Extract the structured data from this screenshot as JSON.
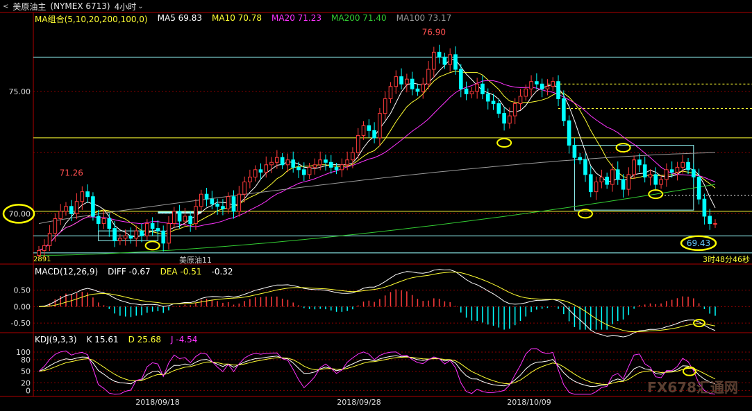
{
  "header": {
    "symbol": "美原油主",
    "code": "(NYMEX 6713)",
    "timeframe": "4小时",
    "timeframe_icon": "chevron-down-icon",
    "prev_icon": "chevron-left-icon"
  },
  "ma_legend": {
    "group": "MA组合(5,10,20,200,100,0)",
    "items": [
      {
        "label": "MA5 69.83",
        "color": "#ffffff"
      },
      {
        "label": "MA10 70.78",
        "color": "#ffff33"
      },
      {
        "label": "MA20 71.23",
        "color": "#ff33ff"
      },
      {
        "label": "MA200 71.40",
        "color": "#33cc33"
      },
      {
        "label": "MA100 73.17",
        "color": "#9a9a9a"
      }
    ]
  },
  "price_panel": {
    "y_ticks": [
      "75.00",
      "70.00"
    ],
    "high_label": "76.90",
    "left_high_label": "71.26",
    "low_label": "69.43",
    "left_tag": "2891",
    "contract_label": "美原油11",
    "countdown": "3时48分46秒"
  },
  "macd_legend": {
    "title": "MACD(12,26,9)",
    "diff": "DIFF -0.67",
    "dea": "DEA -0.51",
    "macd": "-0.32"
  },
  "kdj_legend": {
    "title": "KDJ(9,3,3)",
    "k": "K 15.61",
    "d": "D 25.68",
    "j": "J -4.54"
  },
  "dates": [
    "2018/09/18",
    "2018/09/28",
    "2018/10/09"
  ],
  "watermark": "FX678汇通网",
  "colors": {
    "up": "#ff3b3b",
    "down": "#00ffff",
    "ma5": "#ffffff",
    "ma10": "#ffff33",
    "ma20": "#ff33ff",
    "ma200": "#33cc33",
    "ma100": "#9a9a9a",
    "annotation": "#ffff00",
    "grid": "#8b0000"
  },
  "chart_data": [
    {
      "type": "candlestick",
      "title": "美原油主 (NYMEX 6713) 4小时",
      "y_ticks": [
        75.0,
        70.0
      ],
      "ylim": [
        68.2,
        77.6
      ],
      "x_tick_labels": [
        "2018/09/18",
        "2018/09/28",
        "2018/10/09"
      ],
      "close": [
        68.5,
        68.7,
        69.2,
        69.8,
        70.1,
        70.3,
        70.0,
        70.5,
        70.9,
        70.7,
        69.9,
        69.6,
        69.8,
        69.4,
        68.9,
        69.0,
        69.1,
        69.0,
        69.3,
        69.1,
        69.6,
        69.4,
        69.3,
        68.8,
        69.6,
        70.1,
        69.7,
        69.9,
        69.6,
        70.3,
        70.8,
        70.6,
        70.4,
        70.3,
        70.2,
        70.7,
        70.1,
        70.8,
        71.3,
        71.5,
        71.8,
        71.7,
        72.0,
        72.1,
        72.3,
        72.0,
        72.2,
        71.9,
        71.8,
        71.6,
        71.9,
        72.0,
        72.2,
        72.1,
        71.9,
        71.8,
        72.0,
        72.2,
        72.5,
        73.2,
        73.6,
        73.4,
        73.1,
        74.1,
        74.7,
        75.2,
        75.6,
        75.3,
        75.5,
        75.1,
        75.0,
        75.3,
        75.9,
        76.6,
        76.4,
        76.1,
        76.5,
        75.9,
        75.1,
        74.9,
        75.0,
        75.3,
        74.9,
        74.6,
        74.5,
        74.1,
        73.7,
        74.0,
        74.5,
        74.8,
        75.1,
        75.4,
        75.3,
        75.1,
        75.2,
        75.4,
        74.7,
        73.8,
        72.8,
        72.3,
        72.2,
        71.6,
        70.9,
        71.3,
        71.5,
        71.2,
        71.8,
        71.4,
        71.0,
        71.6,
        72.2,
        72.0,
        71.5,
        71.6,
        71.2,
        71.4,
        71.8,
        71.7,
        71.9,
        72.1,
        71.8,
        71.5,
        70.6,
        69.9,
        69.6,
        69.6
      ],
      "series": [
        {
          "name": "MA5",
          "value": 69.83
        },
        {
          "name": "MA10",
          "value": 70.78
        },
        {
          "name": "MA20",
          "value": 71.23
        },
        {
          "name": "MA200",
          "value": 71.4
        },
        {
          "name": "MA100",
          "value": 73.17
        }
      ],
      "annotations": [
        "76.90",
        "71.26",
        "69.43"
      ]
    },
    {
      "type": "bar",
      "title": "MACD(12,26,9)",
      "y_ticks": [
        0.5,
        0.0,
        -0.5
      ],
      "ylim": [
        -0.75,
        0.85
      ],
      "series": [
        {
          "name": "DIFF",
          "value": -0.67
        },
        {
          "name": "DEA",
          "value": -0.51
        },
        {
          "name": "MACD",
          "value": -0.32
        }
      ]
    },
    {
      "type": "line",
      "title": "KDJ(9,3,3)",
      "y_ticks": [
        100,
        80,
        50,
        20,
        0
      ],
      "ylim": [
        -12,
        118
      ],
      "series": [
        {
          "name": "K",
          "value": 15.61
        },
        {
          "name": "D",
          "value": 25.68
        },
        {
          "name": "J",
          "value": -4.54
        }
      ]
    }
  ]
}
